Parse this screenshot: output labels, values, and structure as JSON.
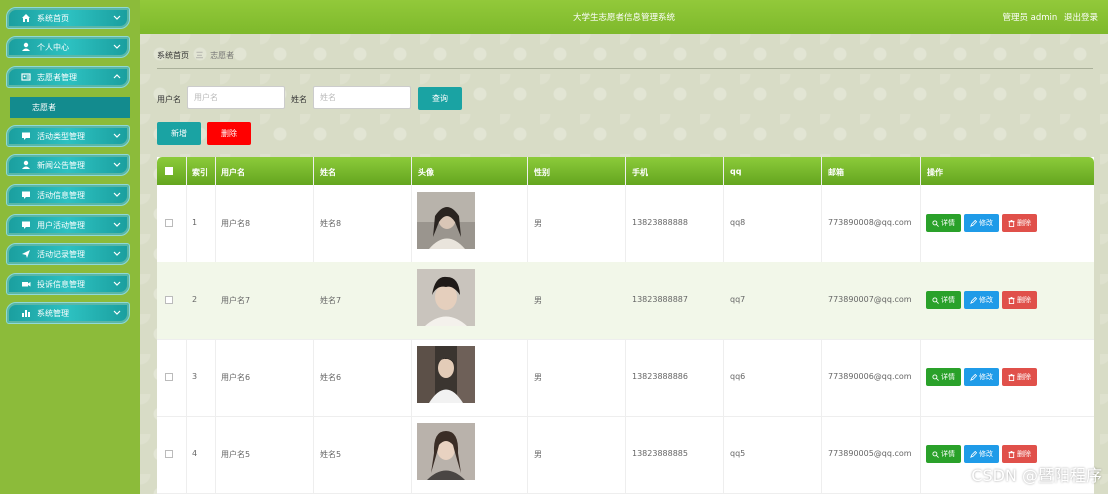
{
  "app": {
    "title": "大学生志愿者信息管理系统",
    "user_label": "管理员 admin",
    "logout_label": "退出登录"
  },
  "sidebar": {
    "items": [
      {
        "label": "系统首页",
        "icon": "home-icon"
      },
      {
        "label": "个人中心",
        "icon": "user-icon"
      },
      {
        "label": "志愿者管理",
        "icon": "volunteer-icon",
        "expanded": true
      },
      {
        "label": "活动类型管理",
        "icon": "comment-icon"
      },
      {
        "label": "新闻公告管理",
        "icon": "user-icon"
      },
      {
        "label": "活动信息管理",
        "icon": "comment-icon"
      },
      {
        "label": "用户活动管理",
        "icon": "comment-icon"
      },
      {
        "label": "活动记录管理",
        "icon": "send-icon"
      },
      {
        "label": "投诉信息管理",
        "icon": "video-icon"
      },
      {
        "label": "系统管理",
        "icon": "bar-chart-icon"
      }
    ],
    "sub_item": "志愿者"
  },
  "breadcrumb": {
    "home": "系统首页",
    "separator": "三",
    "current": "志愿者"
  },
  "search": {
    "username_label": "用户名",
    "username_placeholder": "用户名",
    "username_value": "",
    "name_label": "姓名",
    "name_placeholder": "姓名",
    "name_value": "",
    "query_button": "查询"
  },
  "toolbar": {
    "add_button": "新增",
    "delete_button": "删除"
  },
  "table": {
    "columns": [
      "索引",
      "用户名",
      "姓名",
      "头像",
      "性别",
      "手机",
      "qq",
      "邮箱",
      "操作"
    ],
    "rows": [
      {
        "index": "1",
        "username": "用户名8",
        "name": "姓名8",
        "gender": "男",
        "phone": "13823888888",
        "qq": "qq8",
        "email": "773890008@qq.com"
      },
      {
        "index": "2",
        "username": "用户名7",
        "name": "姓名7",
        "gender": "男",
        "phone": "13823888887",
        "qq": "qq7",
        "email": "773890007@qq.com"
      },
      {
        "index": "3",
        "username": "用户名6",
        "name": "姓名6",
        "gender": "男",
        "phone": "13823888886",
        "qq": "qq6",
        "email": "773890006@qq.com"
      },
      {
        "index": "4",
        "username": "用户名5",
        "name": "姓名5",
        "gender": "男",
        "phone": "13823888885",
        "qq": "qq5",
        "email": "773890005@qq.com"
      }
    ],
    "actions": {
      "detail": "详情",
      "edit": "修改",
      "delete": "删除"
    }
  },
  "watermark": "CSDN @暨阳程序",
  "colors": {
    "sidebar_bg": "#8cbb3a",
    "menu_teal": "#1a9e9e",
    "topbar_green": "#7eb92b",
    "query_button": "#1aa3a3",
    "delete_red": "#ff0000",
    "detail_green": "#2aa12a",
    "edit_blue": "#1f9be8",
    "row_delete": "#e0504a"
  }
}
